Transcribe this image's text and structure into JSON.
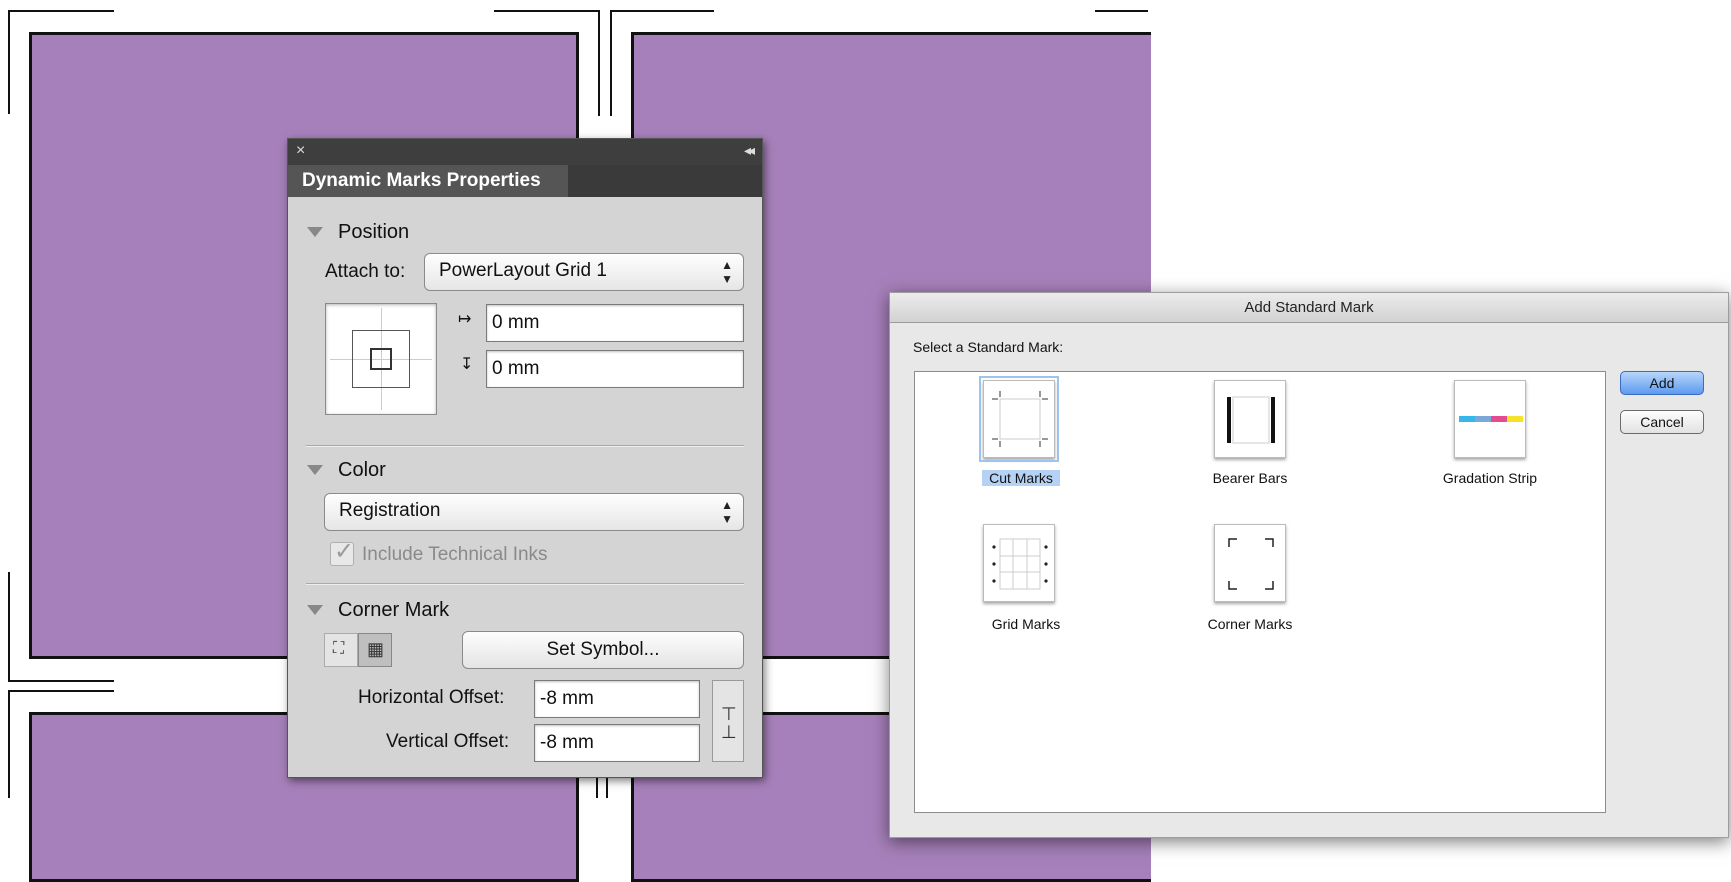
{
  "canvas": {
    "background_color": "#a680ba"
  },
  "dynamic_marks_panel": {
    "tab_title": "Dynamic Marks Properties",
    "close_icon": "×",
    "collapse_icon": "◂◂",
    "position": {
      "title": "Position",
      "attach_label": "Attach to:",
      "attach_value": "PowerLayout Grid 1",
      "x_offset": "0 mm",
      "y_offset": "0 mm"
    },
    "color": {
      "title": "Color",
      "value": "Registration",
      "include_technical_inks": "Include Technical Inks",
      "include_checked": true
    },
    "corner_mark": {
      "title": "Corner Mark",
      "set_symbol": "Set Symbol...",
      "horizontal_label": "Horizontal Offset:",
      "horizontal_value": "-8 mm",
      "vertical_label": "Vertical Offset:",
      "vertical_value": "-8 mm"
    }
  },
  "add_mark_dialog": {
    "title": "Add Standard Mark",
    "prompt": "Select a Standard Mark:",
    "marks": [
      {
        "label": "Cut Marks",
        "icon": "cut-marks-icon",
        "selected": true
      },
      {
        "label": "Bearer Bars",
        "icon": "bearer-bars-icon",
        "selected": false
      },
      {
        "label": "Gradation Strip",
        "icon": "gradation-strip-icon",
        "selected": false
      },
      {
        "label": "Grid Marks",
        "icon": "grid-marks-icon",
        "selected": false
      },
      {
        "label": "Corner Marks",
        "icon": "corner-marks-icon",
        "selected": false
      }
    ],
    "add_button": "Add",
    "cancel_button": "Cancel",
    "default_button_color": "#5d9af0",
    "selection_color": "#b5d1f4"
  }
}
